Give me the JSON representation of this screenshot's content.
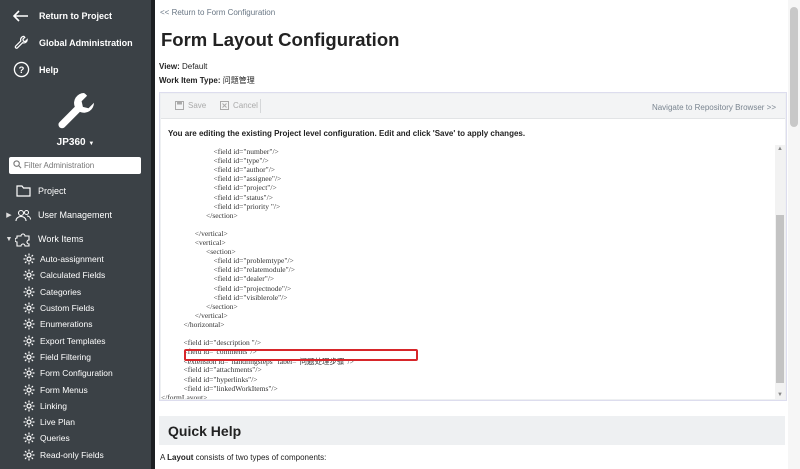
{
  "sidebar": {
    "return_label": "Return to Project",
    "global_admin_label": "Global Administration",
    "help_label": "Help",
    "project_name": "JP360",
    "search_placeholder": "Filter Administration",
    "items": [
      {
        "label": "Project"
      },
      {
        "label": "User Management"
      },
      {
        "label": "Work Items"
      }
    ],
    "sub_items": [
      "Auto-assignment",
      "Calculated Fields",
      "Categories",
      "Custom Fields",
      "Enumerations",
      "Export Templates",
      "Field Filtering",
      "Form Configuration",
      "Form Menus",
      "Linking",
      "Live Plan",
      "Queries",
      "Read-only Fields"
    ]
  },
  "main": {
    "back_link": "<< Return to Form Configuration",
    "title": "Form Layout Configuration",
    "view_label": "View:",
    "view_value": "Default",
    "type_label": "Work Item Type:",
    "type_value": "问题管理",
    "toolbar": {
      "save_label": "Save",
      "cancel_label": "Cancel",
      "navigate_label": "Navigate to Repository Browser >>"
    },
    "notice": "You are editing the existing Project level configuration. Edit and click 'Save' to apply changes.",
    "code_lines": [
      "                            <field id=\"number\"/>",
      "                            <field id=\"type\"/>",
      "                            <field id=\"author\"/>",
      "                            <field id=\"assignee\"/>",
      "                            <field id=\"project\"/>",
      "                            <field id=\"status\"/>",
      "                            <field id=\"priority \"/>",
      "                        </section>",
      "",
      "                  </vertical>",
      "                  <vertical>",
      "                        <section>",
      "                            <field id=\"problemtype\"/>",
      "                            <field id=\"relatemodule\"/>",
      "                            <field id=\"dealer\"/>",
      "                            <field id=\"projectnode\"/>",
      "                            <field id=\"visiblerole\"/>",
      "                        </section>",
      "                  </vertical>",
      "            </horizontal>",
      "",
      "            <field id=\"description \"/>",
      "            <field id=\"comments\"/>",
      "            <extension id=\"handlingsteps\" label=\"问题处理步骤\"/>",
      "            <field id=\"attachments\"/>",
      "            <field id=\"hyperlinks\"/>",
      "            <field id=\"linkedWorkItems\"/>",
      "</formLayout>"
    ],
    "quick_help_title": "Quick Help",
    "quick_help_prefix": "A",
    "quick_help_bold": "Layout",
    "quick_help_suffix": "consists of two types of components:"
  }
}
